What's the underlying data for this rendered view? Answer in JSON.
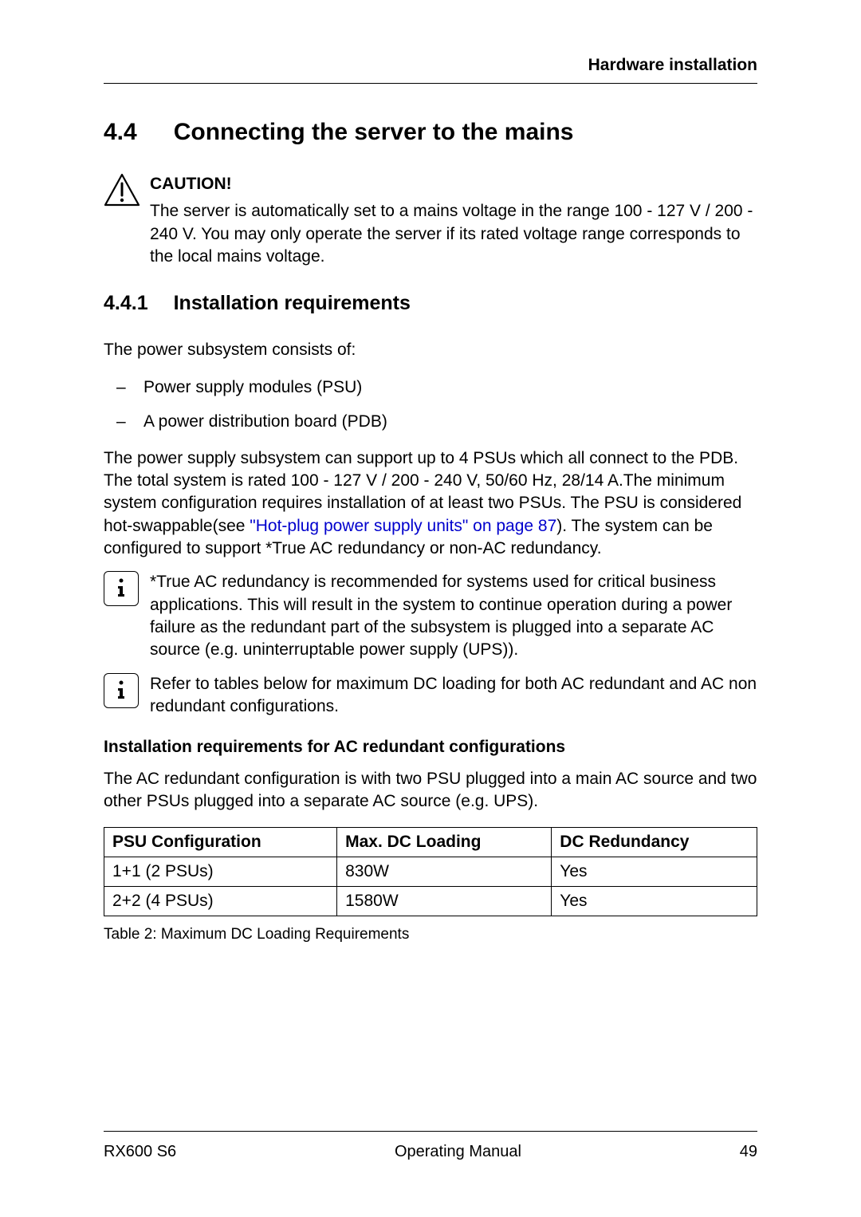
{
  "header": {
    "title": "Hardware installation"
  },
  "section": {
    "number": "4.4",
    "title": "Connecting the server to the mains"
  },
  "caution": {
    "label": "CAUTION!",
    "text": "The server is automatically set to a mains voltage in the range 100 - 127 V / 200 - 240 V. You may only operate the server if its rated voltage range corresponds to the local mains voltage."
  },
  "subsection": {
    "number": "4.4.1",
    "title": "Installation requirements"
  },
  "intro": "The power subsystem consists of:",
  "bullets": [
    "Power supply modules (PSU)",
    "A power distribution board (PDB)"
  ],
  "para1_a": "The power supply subsystem can support up to 4 PSUs which all connect to the PDB. The total system is rated 100 - 127 V / 200 - 240 V, 50/60 Hz, 28/14 A.The minimum system configuration requires installation of at least two PSUs. The PSU is considered hot-swappable(see ",
  "para1_link": "\"Hot-plug power supply units\" on page 87",
  "para1_b": "). The system can be configured to support *True AC redundancy or non-AC redundancy.",
  "info1": "*True AC redundancy is recommended for systems used for critical business applications. This will result in the system to continue operation during a power failure as the redundant part of the subsystem is plugged into a separate AC source (e.g. uninterruptable power supply (UPS)).",
  "info2": "Refer to tables below for maximum DC loading for both AC redundant and AC non redundant configurations.",
  "subhead": "Installation requirements for AC redundant configurations",
  "para2": "The AC redundant configuration is with two PSU plugged into a main AC source and two other PSUs plugged into a separate AC source (e.g. UPS).",
  "chart_data": {
    "type": "table",
    "title": "Table 2: Maximum DC Loading Requirements",
    "columns": [
      "PSU Configuration",
      "Max. DC Loading",
      "DC Redundancy"
    ],
    "rows": [
      [
        "1+1 (2 PSUs)",
        "830W",
        "Yes"
      ],
      [
        "2+2 (4 PSUs)",
        "1580W",
        "Yes"
      ]
    ]
  },
  "footer": {
    "left": "RX600 S6",
    "center": "Operating Manual",
    "right": "49"
  }
}
